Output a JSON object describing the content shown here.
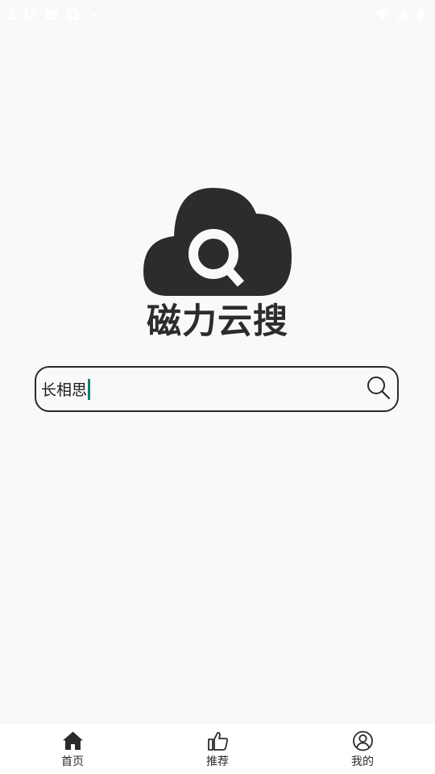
{
  "status_bar": {
    "time": "2:47",
    "left_icons": [
      "image-icon",
      "notification-icon",
      "dot-icon"
    ],
    "right_icons": [
      "wifi-icon",
      "signal-icon",
      "battery-icon"
    ]
  },
  "logo": {
    "text": "磁力云搜",
    "icon": "cloud-search-icon",
    "color": "#2c2c2c"
  },
  "search": {
    "value": "长相思",
    "icon": "search-icon",
    "caret_color": "#0f7f73"
  },
  "bottom_nav": {
    "items": [
      {
        "label": "首页",
        "icon": "home-icon",
        "active": true
      },
      {
        "label": "推荐",
        "icon": "thumbs-up-icon",
        "active": false
      },
      {
        "label": "我的",
        "icon": "user-circle-icon",
        "active": false
      }
    ]
  }
}
